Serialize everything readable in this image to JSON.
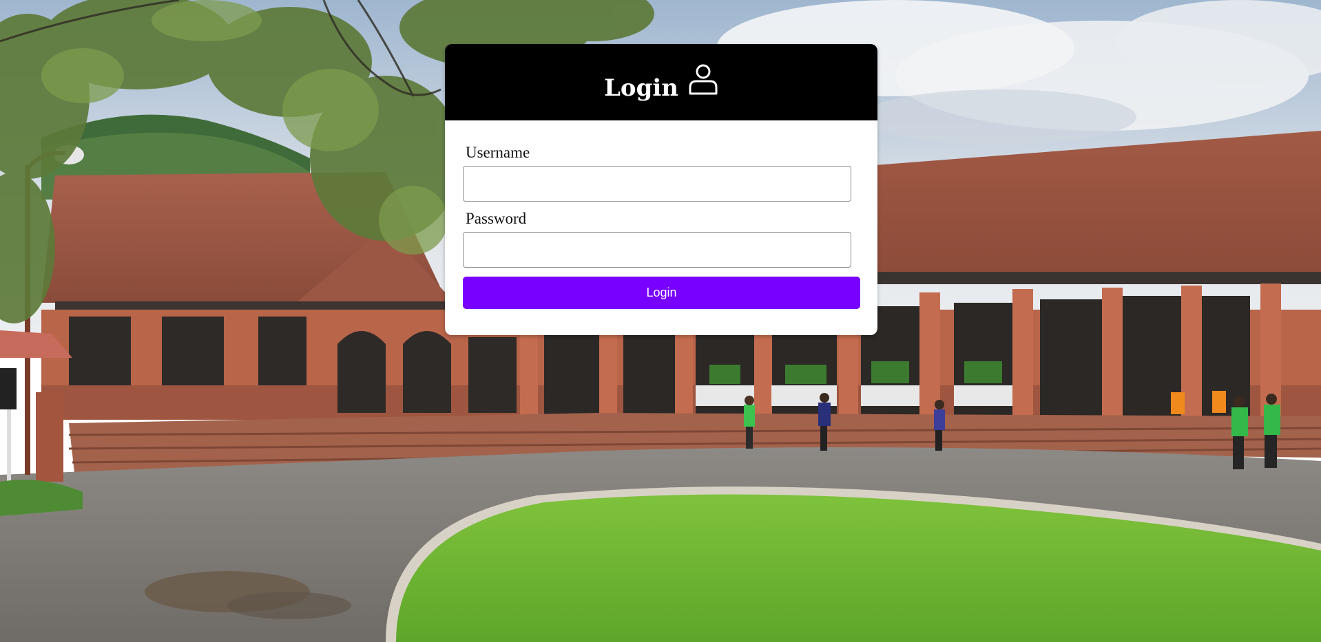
{
  "login": {
    "title": "Login",
    "user_icon": "user-icon",
    "username_label": "Username",
    "username_value": "",
    "password_label": "Password",
    "password_value": "",
    "submit_label": "Login"
  },
  "colors": {
    "header_bg": "#000000",
    "button_bg": "#7700ff",
    "card_bg": "#ffffff"
  }
}
